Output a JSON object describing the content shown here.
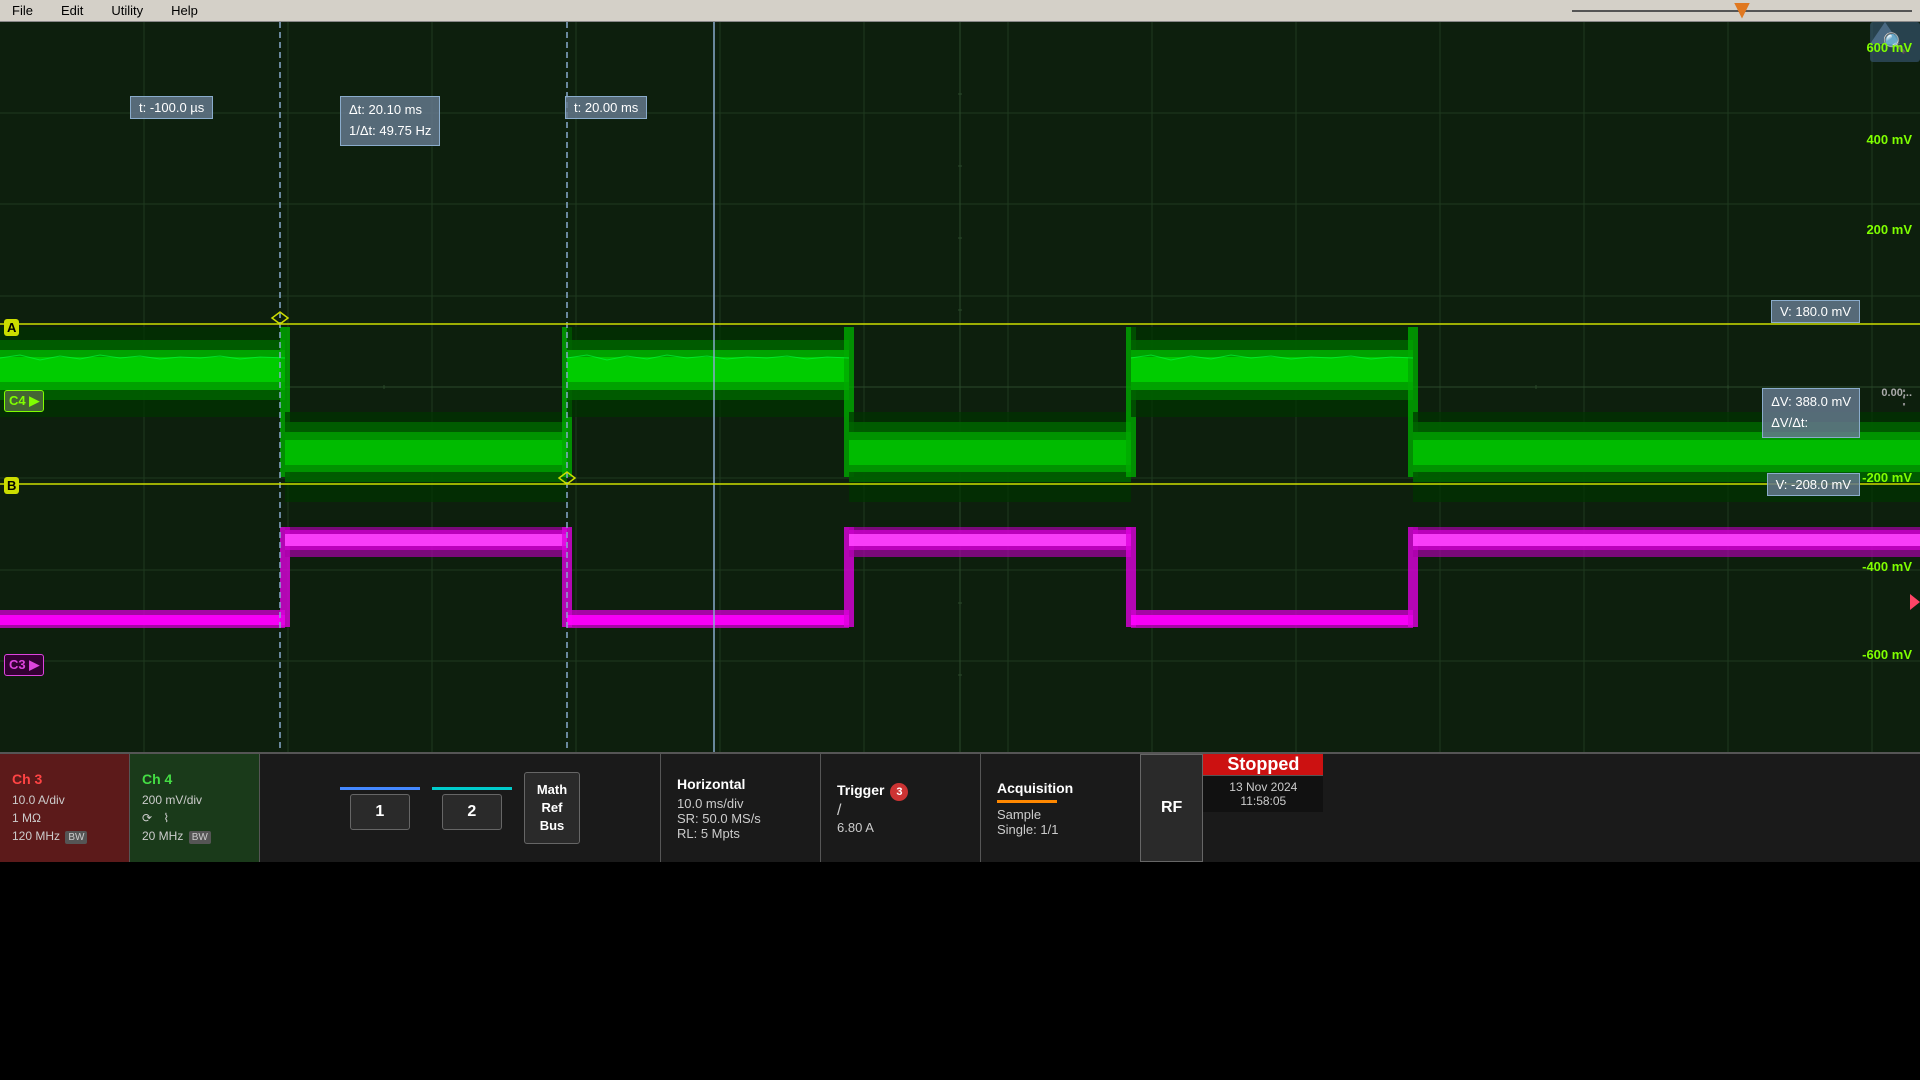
{
  "menubar": {
    "items": [
      "File",
      "Edit",
      "Utility",
      "Help"
    ]
  },
  "scope": {
    "grid_color": "#1e3a1e",
    "grid_major_color": "#2a4a2a",
    "volt_labels": [
      {
        "value": "600 mV",
        "pct": 3
      },
      {
        "value": "400 mV",
        "pct": 17
      },
      {
        "value": "200 mV",
        "pct": 32
      },
      {
        "value": "0.00...",
        "pct": 47
      },
      {
        "value": "-200 mV",
        "pct": 62
      },
      {
        "value": "-400 mV",
        "pct": 76
      },
      {
        "value": "-600 mV",
        "pct": 90
      }
    ],
    "cursors": {
      "t1_label": "t:   -100.0 µs",
      "t2_label": "t:   20.00 ms",
      "delta_label": "Δt:    20.10 ms",
      "freq_label": "1/Δt:  49.75 Hz",
      "v_a_label": "V:   180.0 mV",
      "v_b_label": "V:   -208.0 mV",
      "delta_v_label": "ΔV:      388.0 mV",
      "delta_v_dt_label": "ΔV/Δt:"
    }
  },
  "channels": {
    "ch3": {
      "label": "Ch 3",
      "volts_div": "10.0 A/div",
      "impedance": "1 MΩ",
      "bandwidth": "120 MHz",
      "bw_label": "BW"
    },
    "ch4": {
      "label": "Ch 4",
      "volts_div": "200 mV/div",
      "symbol1": "⟳",
      "symbol2": "⌇",
      "bandwidth": "20 MHz",
      "bw_label": "BW"
    }
  },
  "bottom": {
    "wave1_label": "1",
    "wave2_label": "2",
    "math_ref_bus_label": "Math\nRef\nBus",
    "horizontal": {
      "title": "Horizontal",
      "time_div": "10.0 ms/div",
      "sample_rate": "SR: 50.0 MS/s",
      "record_length": "RL: 5 Mpts"
    },
    "trigger": {
      "title": "Trigger",
      "badge": "3",
      "slope": "/",
      "value": "6.80 A"
    },
    "acquisition": {
      "title": "Acquisition",
      "mode": "Sample",
      "single": "Single: 1/1"
    },
    "rf_label": "RF",
    "stopped_label": "Stopped",
    "date": "13 Nov 2024",
    "time": "11:58:05"
  }
}
